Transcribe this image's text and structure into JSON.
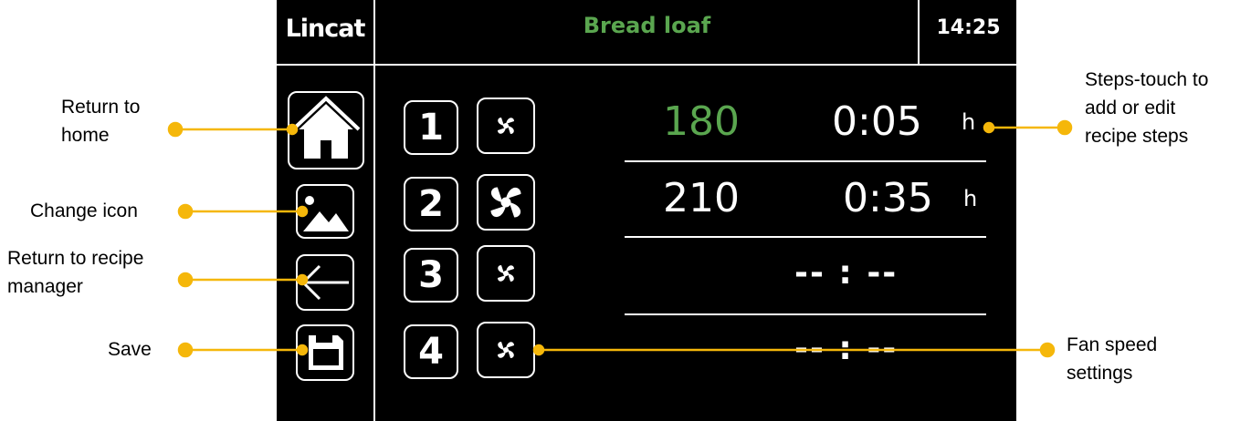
{
  "header": {
    "logo": "Lincat",
    "title": "Bread loaf",
    "clock": "14:25"
  },
  "colors": {
    "title": "#5aa64f",
    "highlight_temp": "#5aa64f",
    "callout_line": "#f5b70a"
  },
  "sidebar": [
    {
      "name": "home-button",
      "icon": "home-icon"
    },
    {
      "name": "change-icon-button",
      "icon": "image-icon"
    },
    {
      "name": "back-button",
      "icon": "arrow-left-icon"
    },
    {
      "name": "save-button",
      "icon": "save-icon"
    }
  ],
  "steps": [
    {
      "number": "1",
      "fan": "small",
      "temp": "180",
      "time": "0:05",
      "unit": "h"
    },
    {
      "number": "2",
      "fan": "large",
      "temp": "210",
      "time": "0:35",
      "unit": "h"
    },
    {
      "number": "3",
      "fan": "small",
      "temp": "",
      "time": "-- : --",
      "unit": ""
    },
    {
      "number": "4",
      "fan": "small",
      "temp": "",
      "time": "-- : --",
      "unit": ""
    }
  ],
  "callouts": {
    "home": "Return to\nhome",
    "change_icon": "Change icon",
    "recipe_manager": "Return to recipe\nmanager",
    "save": "Save",
    "steps": "Steps-touch to\nadd or edit\nrecipe steps",
    "fan": "Fan speed\nsettings"
  }
}
